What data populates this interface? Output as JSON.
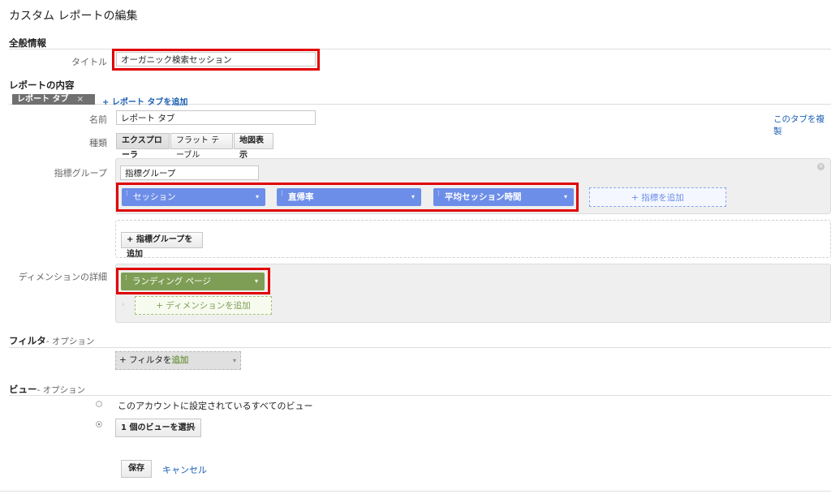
{
  "page_title": "カスタム レポートの編集",
  "general": {
    "heading": "全般情報",
    "title_label": "タイトル",
    "title_value": "オーガニック検索セッション"
  },
  "content": {
    "heading": "レポートの内容",
    "tab_label": "レポート タブ",
    "tab_close": "×",
    "add_tab_link": "+ レポート タブを追加",
    "name_label": "名前",
    "name_value": "レポート タブ",
    "duplicate_link": "このタブを複製",
    "type_label": "種類",
    "types": [
      "エクスプローラ",
      "フラット テーブル",
      "地図表示"
    ],
    "metric_group_label": "指標グループ",
    "metric_group_name": "指標グループ",
    "metrics": [
      "セッション",
      "直帰率",
      "平均セッション時間"
    ],
    "add_metric": "+ 指標を追加",
    "add_metric_group": "+ 指標グループを追加",
    "dimension_label": "ディメンションの詳細",
    "dimension": "ランディング ページ",
    "add_dimension": "+ ディメンションを追加"
  },
  "filter": {
    "heading": "フィルタ",
    "optional": "- オプション",
    "add_filter_prefix": "+ フィルタを",
    "add_filter_accent": "追加"
  },
  "view": {
    "heading": "ビュー",
    "optional": "- オプション",
    "option_all": "このアカウントに設定されているすべてのビュー",
    "option_select": "1 個のビューを選択"
  },
  "actions": {
    "save": "保存",
    "cancel": "キャンセル"
  },
  "colors": {
    "metric_pill": "#6d8ee8",
    "dimension_pill": "#7e9e55",
    "highlight": "#e00000",
    "link": "#1a5fb4"
  }
}
